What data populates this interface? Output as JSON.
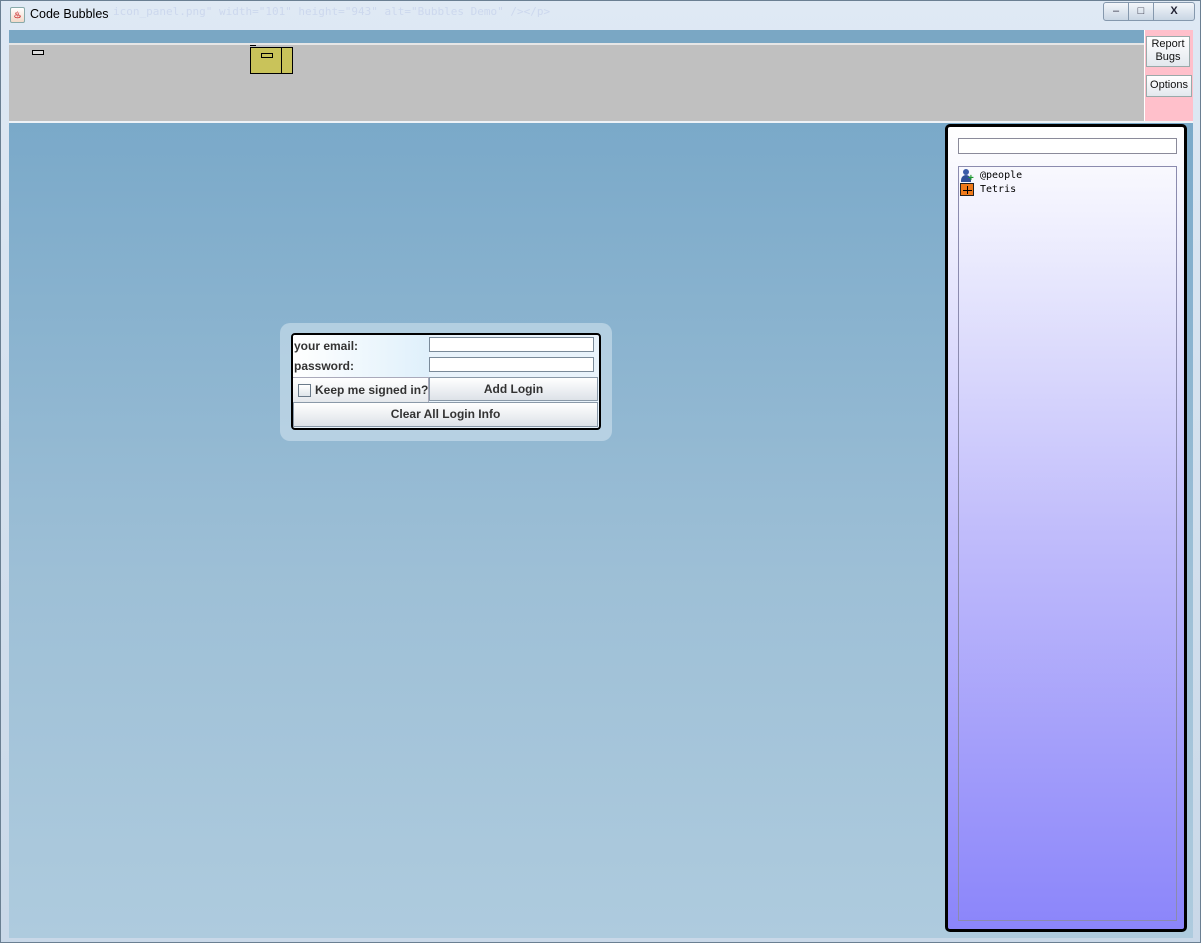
{
  "window": {
    "title": "Code Bubbles",
    "ghost_text": "icon_panel.png\" width=\"101\" height=\"943\" alt=\"Bubbles Demo\" /></p>",
    "minimize_symbol": "–",
    "maximize_symbol": "□",
    "close_symbol": "X"
  },
  "side_buttons": {
    "report_bugs_label": "Report Bugs",
    "options_label": "Options"
  },
  "login": {
    "email_label": "your email:",
    "password_label": "password:",
    "email_value": "",
    "password_value": "",
    "keep_signed_in_label": "Keep me signed in?",
    "keep_signed_in_checked": false,
    "add_login_label": "Add Login",
    "clear_label": "Clear All Login Info"
  },
  "side_panel": {
    "search_value": "",
    "items": [
      {
        "label": "@people",
        "icon": "people-icon"
      },
      {
        "label": "Tetris",
        "icon": "tetris-icon"
      }
    ]
  },
  "colors": {
    "desktop_top": "#7aa9c9",
    "desktop_bottom": "#aecbde",
    "overview_bg": "#c0c0c0",
    "side_buttons_bg": "#ffc0cb",
    "viewport_box": "#c9c35a",
    "side_panel_bottom": "#8b85fa"
  }
}
